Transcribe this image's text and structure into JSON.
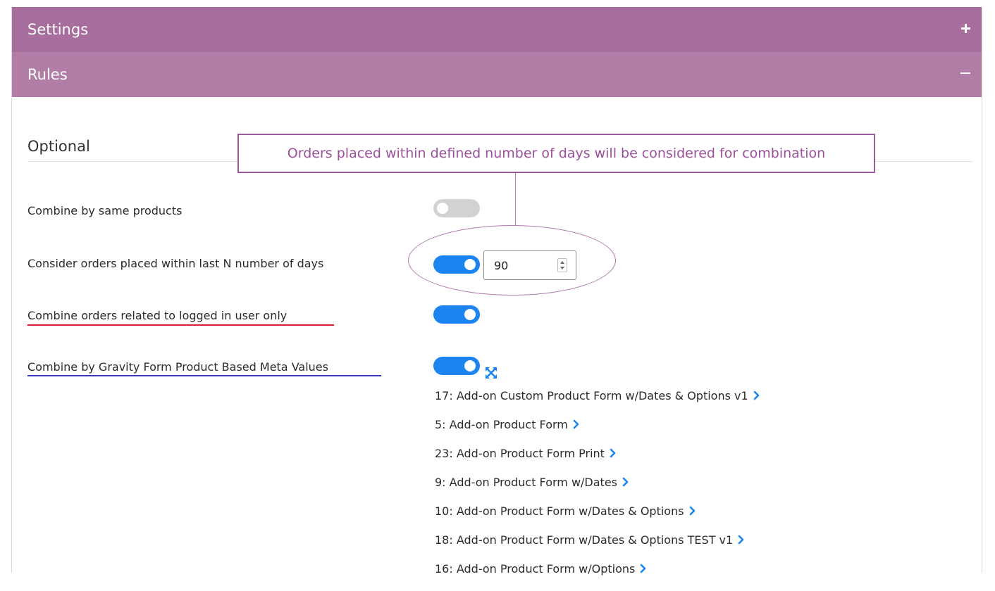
{
  "header": {
    "settings_label": "Settings",
    "rules_label": "Rules"
  },
  "section": {
    "title": "Optional"
  },
  "callout": {
    "text": "Orders placed within defined number of days will be considered for combination"
  },
  "options": [
    {
      "label": "Combine by same products",
      "enabled": false
    },
    {
      "label": "Consider orders placed within last N number of days",
      "enabled": true,
      "value": "90"
    },
    {
      "label": "Combine orders related to logged in user only",
      "enabled": true
    },
    {
      "label": "Combine by Gravity Form Product Based Meta Values",
      "enabled": true
    }
  ],
  "forms": [
    "17: Add-on Custom Product Form w/Dates & Options v1",
    "5: Add-on Product Form",
    "23: Add-on Product Form Print",
    "9: Add-on Product Form w/Dates",
    "10: Add-on Product Form w/Dates & Options",
    "18: Add-on Product Form w/Dates & Options TEST v1",
    "16: Add-on Product Form w/Options"
  ],
  "colors": {
    "header": "#a76d9d",
    "header_secondary": "#b27ea8",
    "toggle_on": "#1c84f0",
    "toggle_off": "#d2d2d2",
    "callout": "#9b4f9b",
    "underline_red": "#d4232f",
    "underline_blue": "#3a3abf"
  },
  "icons": {
    "settings_toggle": "plus-icon",
    "rules_toggle": "minus-icon",
    "expand": "expand-icon",
    "item_chevron": "chevron-right-icon"
  }
}
